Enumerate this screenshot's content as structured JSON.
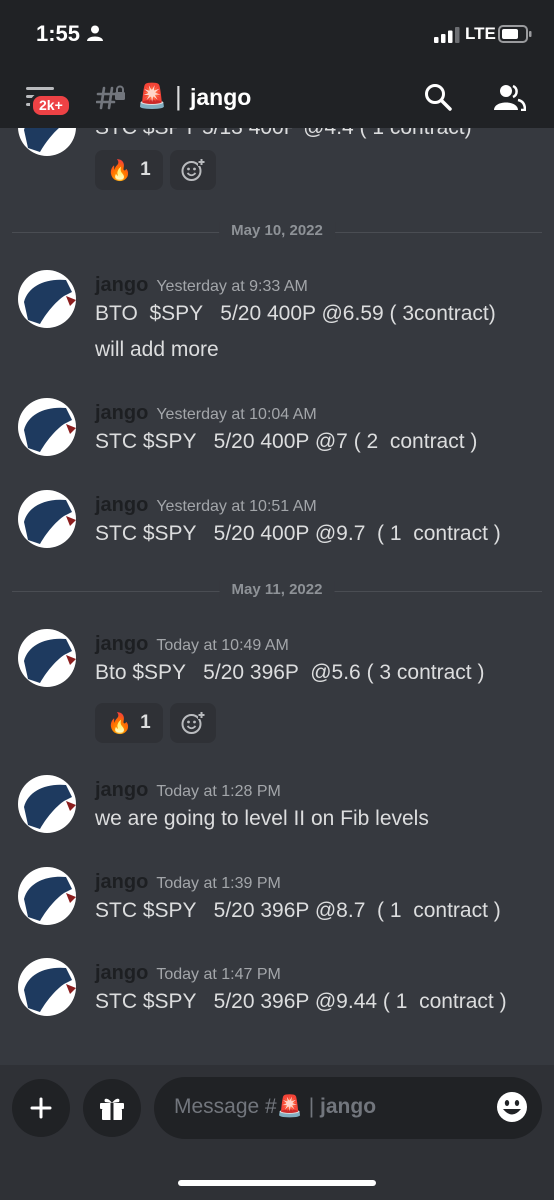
{
  "status_bar": {
    "time": "1:55",
    "network": "LTE"
  },
  "header": {
    "unread_badge": "2k+",
    "channel_emoji": "🚨",
    "separator": "|",
    "channel_name": "jango"
  },
  "cut_off_message": {
    "text": "STC $SPY 5/13 400P @4.4 ( 1 contract)",
    "reaction": {
      "emoji": "🔥",
      "count": "1"
    }
  },
  "dividers": {
    "may10": "May 10, 2022",
    "may11": "May 11, 2022"
  },
  "messages": [
    {
      "author": "jango",
      "timestamp": "Yesterday at 9:33 AM",
      "lines": [
        "BTO  $SPY   5/20 400P @6.59 ( 3contract)",
        "will add more"
      ]
    },
    {
      "author": "jango",
      "timestamp": "Yesterday at 10:04 AM",
      "lines": [
        "STC $SPY   5/20 400P @7 ( 2  contract )"
      ]
    },
    {
      "author": "jango",
      "timestamp": "Yesterday at 10:51 AM",
      "lines": [
        "STC $SPY   5/20 400P @9.7  ( 1  contract )"
      ]
    },
    {
      "author": "jango",
      "timestamp": "Today at 10:49 AM",
      "lines": [
        "Bto $SPY   5/20 396P  @5.6 ( 3 contract )"
      ],
      "reaction": {
        "emoji": "🔥",
        "count": "1"
      }
    },
    {
      "author": "jango",
      "timestamp": "Today at 1:28 PM",
      "lines": [
        "we are going to level II on Fib levels"
      ]
    },
    {
      "author": "jango",
      "timestamp": "Today at 1:39 PM",
      "lines": [
        "STC $SPY   5/20 396P @8.7  ( 1  contract )"
      ]
    },
    {
      "author": "jango",
      "timestamp": "Today at 1:47 PM",
      "lines": [
        "STC $SPY   5/20 396P @9.44 ( 1  contract )"
      ]
    }
  ],
  "composer": {
    "placeholder_prefix": "Message #",
    "placeholder_emoji": "🚨",
    "placeholder_sep": "|",
    "placeholder_channel": "jango"
  },
  "colors": {
    "background": "#36393f",
    "header": "#202225",
    "badge": "#ed4245",
    "author": "#1d1f22"
  }
}
